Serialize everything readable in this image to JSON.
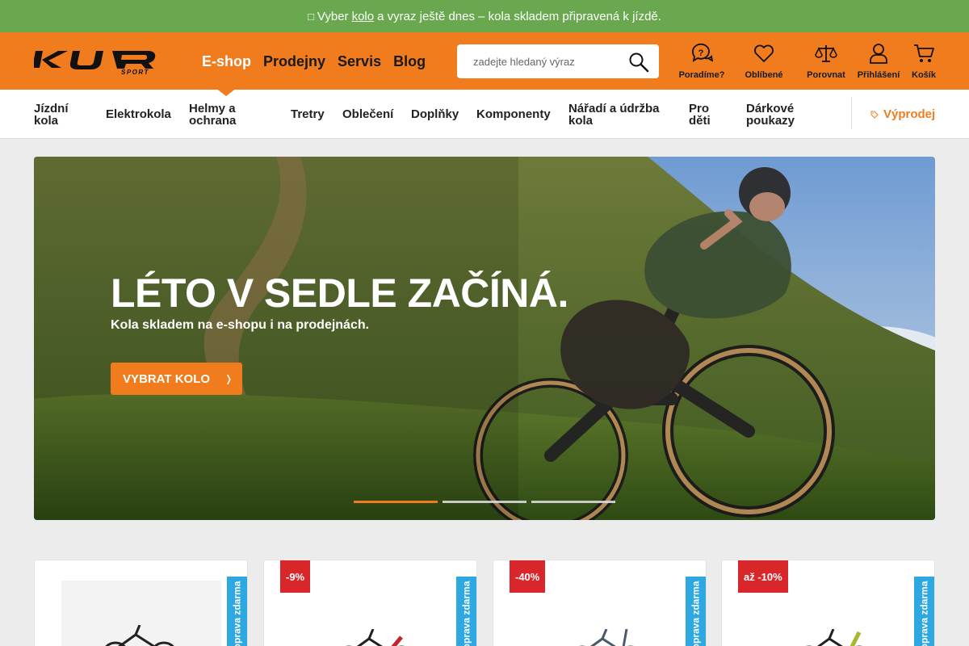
{
  "promo": {
    "icon": "bike-icon",
    "text_before": "Vyber",
    "link": "kolo",
    "text_after": "a vyraz ještě dnes – kola skladem připravená k jízdě."
  },
  "header": {
    "logo_alt": "KUR SPORT",
    "nav": [
      {
        "label": "E-shop",
        "active": true
      },
      {
        "label": "Prodejny"
      },
      {
        "label": "Servis"
      },
      {
        "label": "Blog"
      }
    ],
    "search": {
      "placeholder": "zadejte hledaný výraz",
      "value": ""
    },
    "icons": [
      {
        "label": "Poradíme?",
        "icon": "help-chat-icon"
      },
      {
        "label": "Oblíbené",
        "icon": "heart-icon"
      },
      {
        "label": "Porovnat",
        "icon": "scales-icon"
      },
      {
        "label": "Přihlášení",
        "icon": "user-icon"
      },
      {
        "label": "Košík",
        "icon": "cart-icon"
      }
    ]
  },
  "categories": [
    "Jízdní kola",
    "Elektrokola",
    "Helmy a ochrana",
    "Tretry",
    "Oblečení",
    "Doplňky",
    "Komponenty",
    "Nářadí a údržba kola",
    "Pro děti",
    "Dárkové poukazy"
  ],
  "sale_label": "Výprodej",
  "hero": {
    "title": "LÉTO V SEDLE ZAČÍNÁ.",
    "subtitle": "Kola skladem na e-shopu i na prodejnách.",
    "button": "VYBRAT KOLO",
    "slides_total": 3,
    "active_slide": 1
  },
  "products": [
    {
      "badge": "",
      "shipping": "Doprava zdarma"
    },
    {
      "badge": "-9%",
      "shipping": "Doprava zdarma"
    },
    {
      "badge": "-40%",
      "shipping": "Doprava zdarma"
    },
    {
      "badge": "až -10%",
      "shipping": "Doprava zdarma"
    }
  ],
  "colors": {
    "brand_orange": "#f07c1e",
    "promo_green": "#6aa84f",
    "discount_red": "#d9262a",
    "shipping_blue": "#2da8e0"
  }
}
